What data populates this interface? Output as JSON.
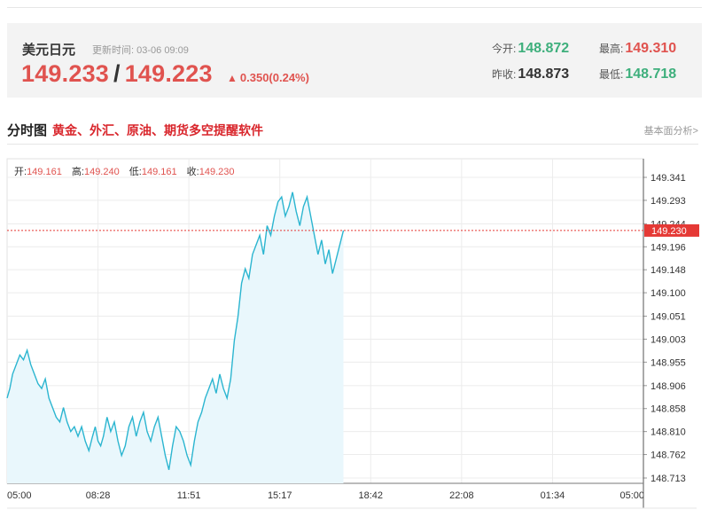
{
  "quote": {
    "name": "美元日元",
    "update_label": "更新时间:",
    "update_time": "03-06 09:09",
    "price_a": "149.233",
    "slash": "/",
    "price_b": "149.223",
    "change": "0.350(0.24%)",
    "open_label": "今开:",
    "open_value": "148.872",
    "high_label": "最高:",
    "high_value": "149.310",
    "prev_label": "昨收:",
    "prev_value": "148.873",
    "low_label": "最低:",
    "low_value": "148.718",
    "colors": {
      "up": "#e0534f",
      "down": "#3eaf7c"
    }
  },
  "section": {
    "title": "分时图",
    "ad": "黄金、外汇、原油、期货多空提醒软件",
    "link": "基本面分析>"
  },
  "ohlc": {
    "open_label": "开:",
    "open": "149.161",
    "high_label": "高:",
    "high": "149.240",
    "low_label": "低:",
    "low": "149.161",
    "close_label": "收:",
    "close": "149.230"
  },
  "chart_data": {
    "type": "line",
    "x_tick_labels": [
      "05:00",
      "08:28",
      "11:51",
      "15:17",
      "18:42",
      "22:08",
      "01:34",
      "05:00"
    ],
    "y_tick_labels": [
      "149.341",
      "149.293",
      "149.244",
      "149.196",
      "149.148",
      "149.100",
      "149.051",
      "149.003",
      "148.955",
      "148.906",
      "148.858",
      "148.810",
      "148.762",
      "148.713"
    ],
    "ylim": [
      148.713,
      149.341
    ],
    "reference_line": {
      "label": "149.230",
      "value": 149.23,
      "color": "#e53935"
    },
    "series": [
      {
        "color": "#2bb5d0",
        "fill": "#e9f7fc",
        "x": [
          0,
          0.03,
          0.06,
          0.1,
          0.14,
          0.18,
          0.22,
          0.26,
          0.3,
          0.34,
          0.38,
          0.42,
          0.46,
          0.5,
          0.54,
          0.58,
          0.62,
          0.66,
          0.7,
          0.74,
          0.78,
          0.82,
          0.86,
          0.9,
          0.94,
          0.97,
          1.0,
          1.03,
          1.06,
          1.1,
          1.14,
          1.18,
          1.22,
          1.26,
          1.3,
          1.34,
          1.38,
          1.42,
          1.46,
          1.5,
          1.54,
          1.58,
          1.62,
          1.66,
          1.7,
          1.74,
          1.78,
          1.82,
          1.86,
          1.9,
          1.94,
          1.98,
          2.02,
          2.06,
          2.1,
          2.14,
          2.18,
          2.22,
          2.26,
          2.3,
          2.34,
          2.38,
          2.42,
          2.46,
          2.5,
          2.54,
          2.58,
          2.62,
          2.66,
          2.7,
          2.74,
          2.78,
          2.82,
          2.86,
          2.9,
          2.94,
          2.98,
          3.02,
          3.06,
          3.1,
          3.14,
          3.18,
          3.22,
          3.26,
          3.3,
          3.34,
          3.38,
          3.42,
          3.46,
          3.5,
          3.54,
          3.58,
          3.62,
          3.66,
          3.7
        ],
        "y": [
          148.88,
          148.9,
          148.93,
          148.95,
          148.97,
          148.96,
          148.98,
          148.95,
          148.93,
          148.91,
          148.9,
          148.92,
          148.88,
          148.86,
          148.84,
          148.83,
          148.86,
          148.83,
          148.81,
          148.82,
          148.8,
          148.82,
          148.79,
          148.77,
          148.8,
          148.82,
          148.79,
          148.78,
          148.8,
          148.84,
          148.81,
          148.83,
          148.79,
          148.76,
          148.78,
          148.82,
          148.84,
          148.8,
          148.83,
          148.85,
          148.81,
          148.79,
          148.82,
          148.84,
          148.8,
          148.76,
          148.73,
          148.78,
          148.82,
          148.81,
          148.79,
          148.76,
          148.74,
          148.79,
          148.83,
          148.85,
          148.88,
          148.9,
          148.92,
          148.89,
          148.93,
          148.9,
          148.88,
          148.92,
          149.0,
          149.05,
          149.12,
          149.15,
          149.13,
          149.18,
          149.2,
          149.22,
          149.18,
          149.24,
          149.22,
          149.26,
          149.29,
          149.3,
          149.26,
          149.28,
          149.31,
          149.27,
          149.24,
          149.28,
          149.3,
          149.26,
          149.22,
          149.18,
          149.21,
          149.16,
          149.19,
          149.14,
          149.17,
          149.2,
          149.23
        ]
      }
    ],
    "grid": true
  }
}
